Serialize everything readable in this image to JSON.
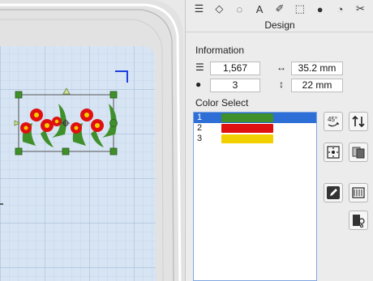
{
  "toolbar": {
    "tools": [
      {
        "name": "select-icon",
        "glyph": "☰"
      },
      {
        "name": "point-icon",
        "glyph": "◇"
      },
      {
        "name": "lasso-icon",
        "glyph": "◌"
      },
      {
        "name": "text-icon",
        "glyph": "A"
      },
      {
        "name": "paint-icon",
        "glyph": "✐"
      },
      {
        "name": "frame-icon",
        "glyph": "⬚"
      },
      {
        "name": "stitch-icon",
        "glyph": "●"
      },
      {
        "name": "clock-icon",
        "glyph": "◔"
      },
      {
        "name": "scissors-icon",
        "glyph": "✂"
      }
    ]
  },
  "panel": {
    "title": "Design",
    "information_label": "Information",
    "stitch_count": "1,567",
    "width": "35.2 mm",
    "color_count": "3",
    "height": "22 mm",
    "color_select_label": "Color Select"
  },
  "colors": [
    {
      "index": "1",
      "color": "#3f8f2a",
      "selected": true
    },
    {
      "index": "2",
      "color": "#e01010",
      "selected": false
    },
    {
      "index": "3",
      "color": "#f2d000",
      "selected": false
    }
  ],
  "side_buttons": [
    {
      "name": "rotate-45-icon"
    },
    {
      "name": "flip-vertical-icon"
    },
    {
      "name": "center-icon"
    },
    {
      "name": "duplicate-icon"
    },
    {
      "name": "edit-icon"
    },
    {
      "name": "border-icon"
    },
    {
      "name": "stitch-order-icon"
    }
  ],
  "accent": "#2d6fd6"
}
